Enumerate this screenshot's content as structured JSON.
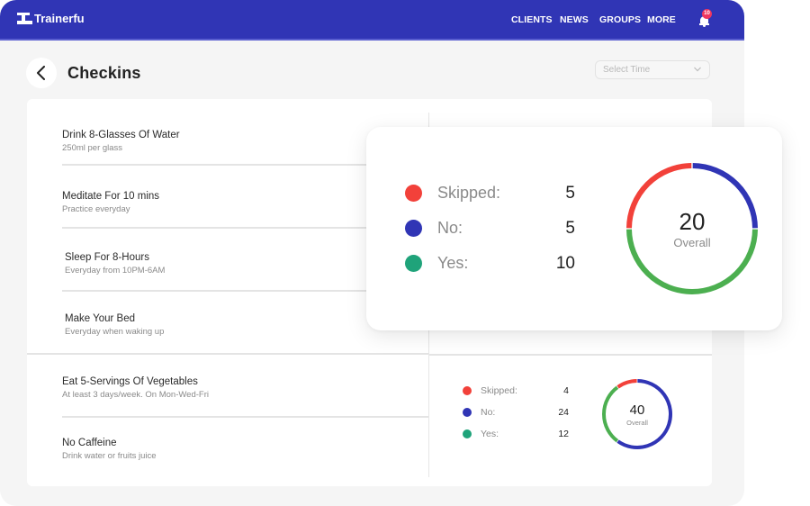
{
  "app": {
    "brand": "Trainerfu",
    "nav": [
      "CLIENTS",
      "NEWS",
      "GROUPS",
      "MORE"
    ],
    "notifications_count": "10",
    "brand_color": "#3035b5"
  },
  "page": {
    "title": "Checkins",
    "time_select": {
      "placeholder": "Select Time",
      "value": ""
    }
  },
  "checkins": [
    {
      "title": "Drink 8-Glasses Of Water",
      "subtitle": "250ml per glass"
    },
    {
      "title": "Meditate For 10 mins",
      "subtitle": "Practice everyday"
    },
    {
      "title": "Sleep For 8-Hours",
      "subtitle": "Everyday from 10PM-6AM"
    },
    {
      "title": "Make Your Bed",
      "subtitle": "Everyday when waking up"
    },
    {
      "title": "Eat 5-Servings Of Vegetables",
      "subtitle": "At least 3 days/week. On Mon-Wed-Fri"
    },
    {
      "title": "No Caffeine",
      "subtitle": "Drink water or fruits juice"
    }
  ],
  "colors": {
    "skipped": "#f2413a",
    "no": "#3035b5",
    "yes": "#1fa37a",
    "yes_ring": "#4caf50"
  },
  "chart_data": [
    {
      "type": "pie",
      "title": "Overall",
      "total": 20,
      "center_label": "Overall",
      "categories": [
        "Skipped",
        "No",
        "Yes"
      ],
      "values": [
        5,
        5,
        10
      ],
      "legend": [
        {
          "label": "Skipped:",
          "value": "5"
        },
        {
          "label": "No:",
          "value": "5"
        },
        {
          "label": "Yes:",
          "value": "10"
        }
      ]
    },
    {
      "type": "pie",
      "title": "Overall",
      "total": 40,
      "center_label": "Overall",
      "categories": [
        "Skipped",
        "No",
        "Yes"
      ],
      "values": [
        4,
        24,
        12
      ],
      "legend": [
        {
          "label": "Skipped:",
          "value": "4"
        },
        {
          "label": "No:",
          "value": "24"
        },
        {
          "label": "Yes:",
          "value": "12"
        }
      ]
    }
  ]
}
